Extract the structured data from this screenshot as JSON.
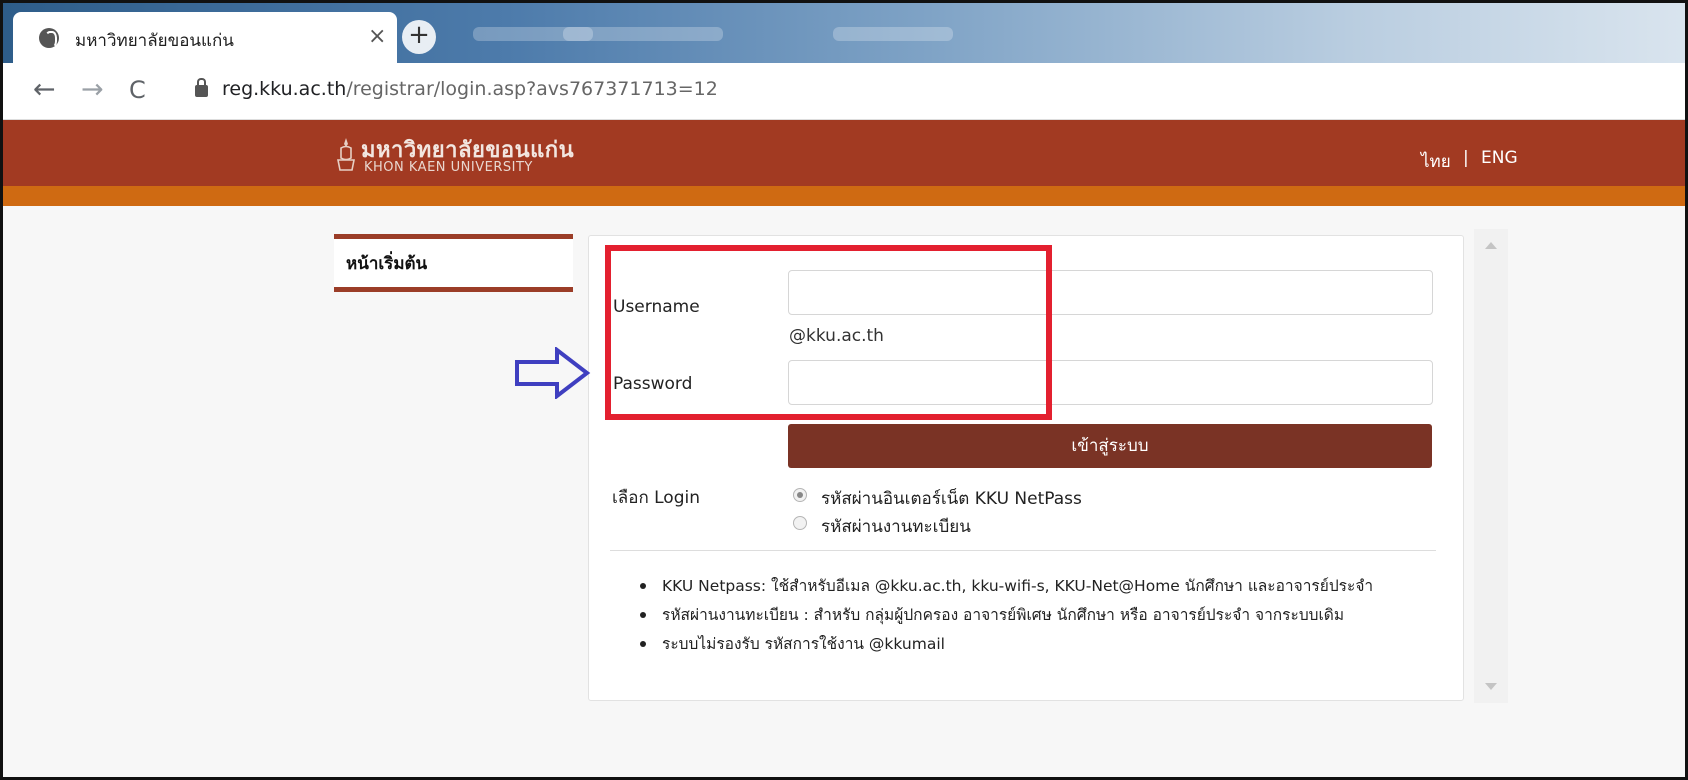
{
  "browser": {
    "tab_title": "มหาวิทยาลัยขอนแก่น",
    "tab_close": "×",
    "new_tab": "+",
    "back": "←",
    "forward": "→",
    "reload": "C",
    "url_host": "reg.kku.ac.th",
    "url_path": "/registrar/login.asp?avs767371713=12"
  },
  "header": {
    "logo_thai": "มหาวิทยาลัยขอนแก่น",
    "logo_english": "KHON KAEN UNIVERSITY",
    "lang_thai": "ไทย",
    "lang_separator": "|",
    "lang_english": "ENG"
  },
  "sidebar": {
    "home_label": "หน้าเริ่มต้น"
  },
  "form": {
    "username_label": "Username",
    "username_value": "",
    "domain_hint": "@kku.ac.th",
    "password_label": "Password",
    "password_value": "",
    "submit_label": "เข้าสู่ระบบ",
    "login_choice_label": "เลือก Login",
    "options": [
      {
        "label": "รหัสผ่านอินเตอร์เน็ต KKU NetPass",
        "selected": true
      },
      {
        "label": "รหัสผ่านงานทะเบียน",
        "selected": false
      }
    ]
  },
  "notes": [
    "KKU Netpass: ใช้สำหรับอีเมล @kku.ac.th, kku-wifi-s, KKU-Net@Home นักศึกษา และอาจารย์ประจำ",
    "รหัสผ่านงานทะเบียน : สำหรับ กลุ่มผู้ปกครอง อาจารย์พิเศษ นักศึกษา หรือ อาจารย์ประจำ จากระบบเดิม",
    "ระบบไม่รองรับ รหัสการใช้งาน @kkumail"
  ],
  "colors": {
    "header_red": "#a23a22",
    "orange_bar": "#cf6a12",
    "button_maroon": "#7a3325",
    "highlight_red": "#e3202f",
    "arrow_blue": "#3f3fc0"
  }
}
